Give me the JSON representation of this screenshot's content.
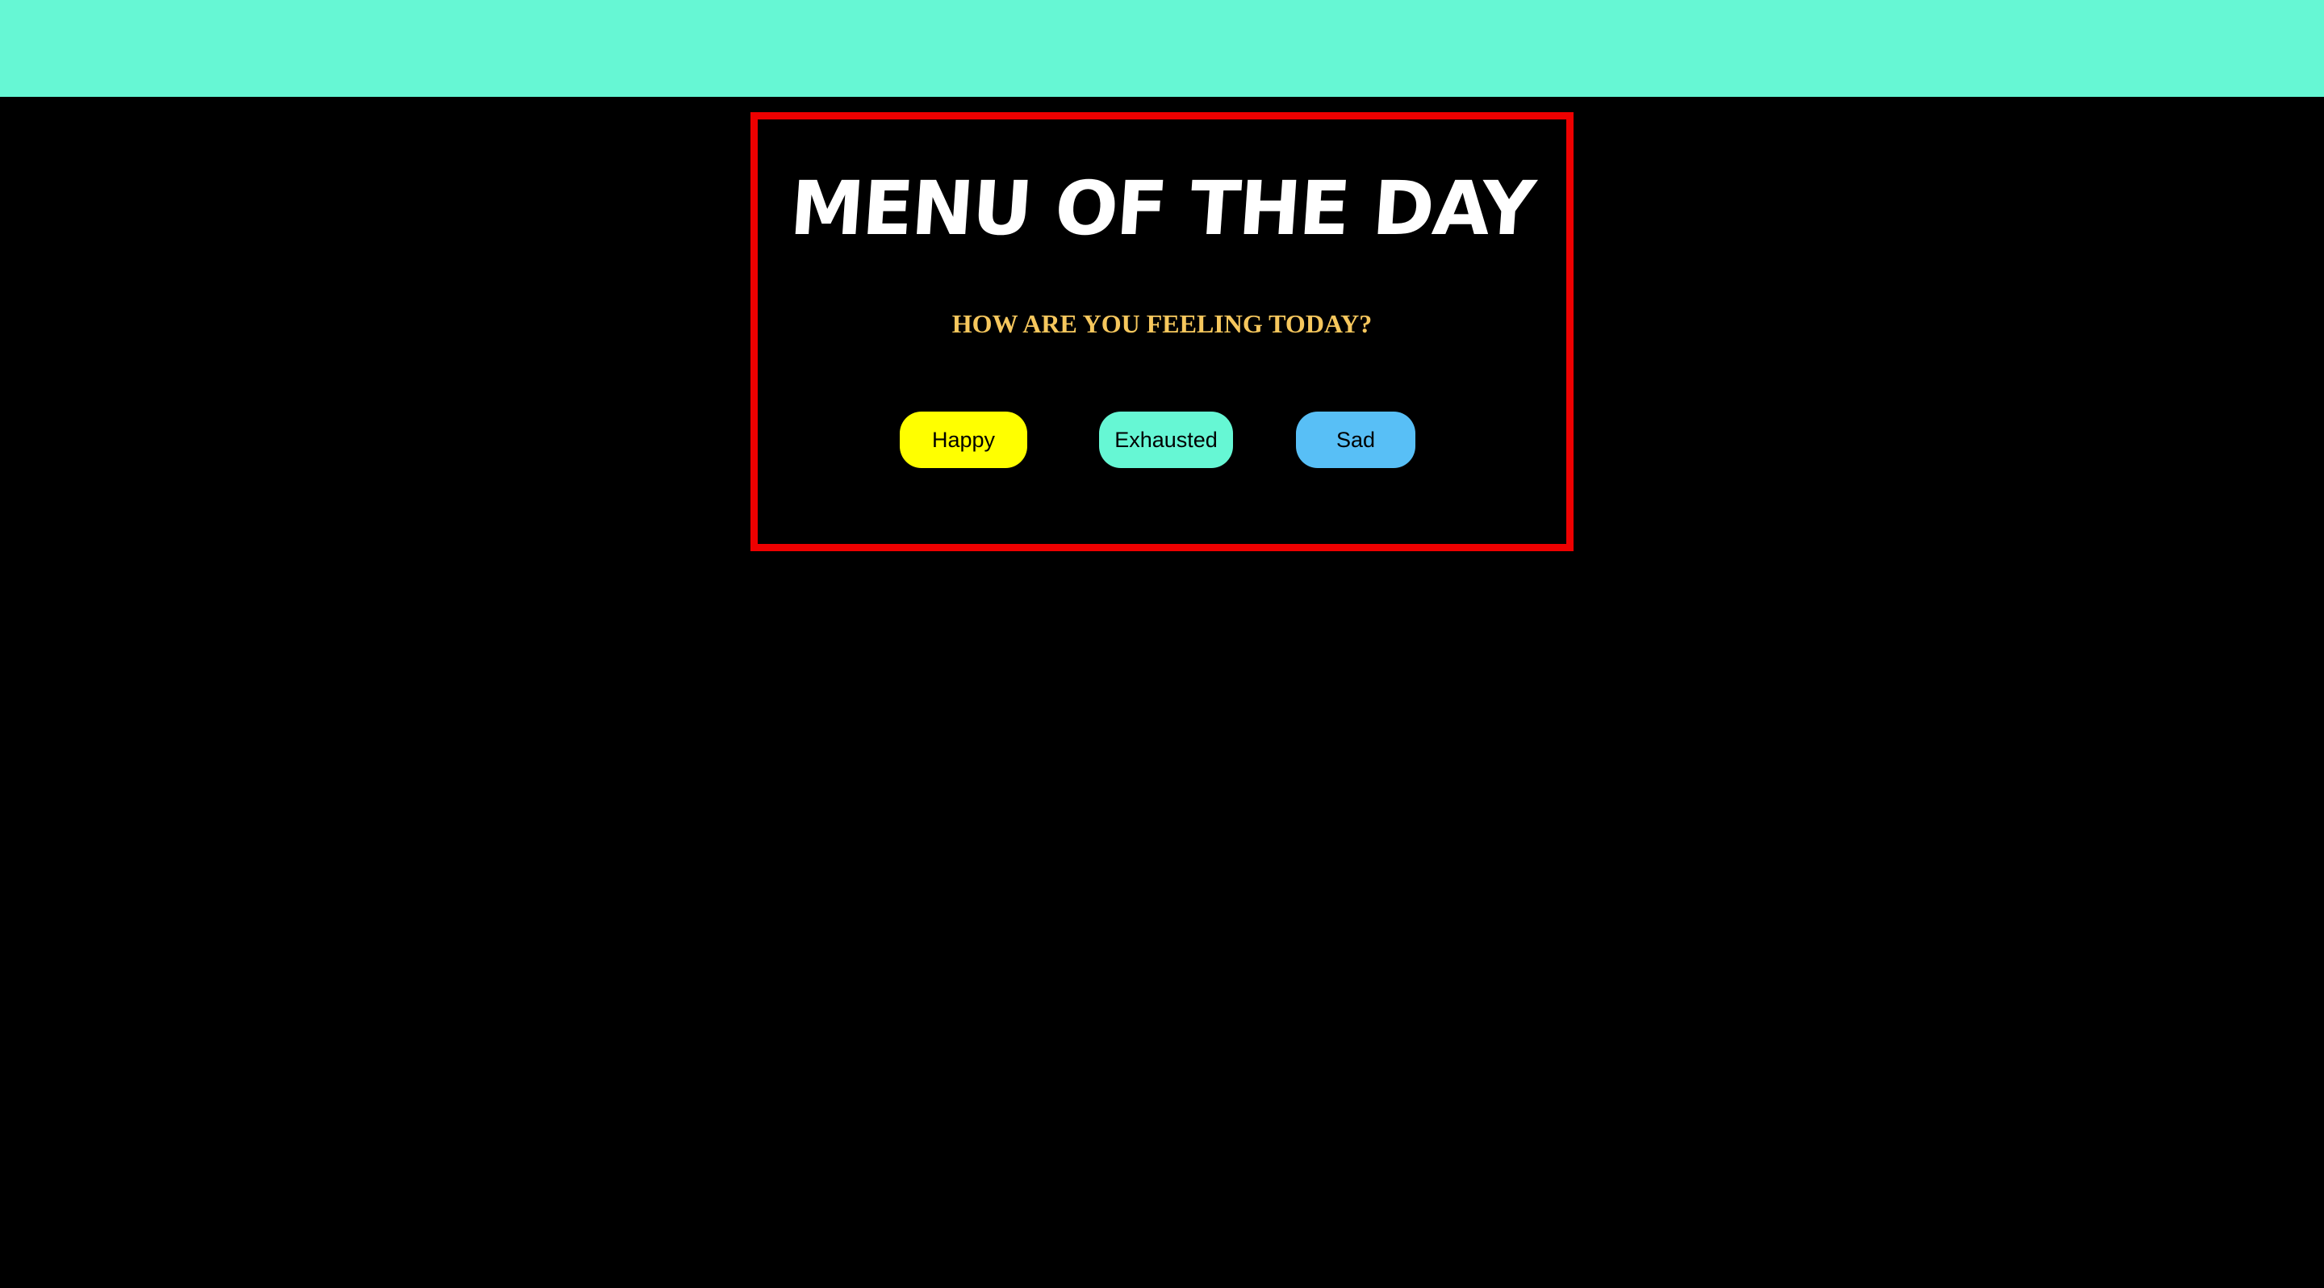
{
  "colors": {
    "top_bar": "#66f7d4",
    "background": "#000000",
    "panel_border": "#ee0000",
    "title": "#ffffff",
    "question": "#f6c75d",
    "happy": "#ffff00",
    "exhausted": "#66f7d4",
    "sad": "#58bff6"
  },
  "menu": {
    "title": "MENU OF THE DAY",
    "question": "HOW ARE YOU FEELING TODAY?",
    "buttons": [
      {
        "label": "Happy"
      },
      {
        "label": "Exhausted"
      },
      {
        "label": "Sad"
      }
    ]
  }
}
